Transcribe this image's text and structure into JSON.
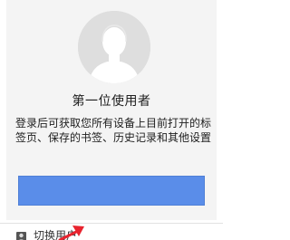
{
  "profile": {
    "name": "第一位使用者",
    "description": "登录后可获取您所有设备上目前打开的标签页、保存的书签、历史记录和其他设置",
    "signin_button_label": "",
    "avatar_icon": "person-silhouette-icon"
  },
  "menu": {
    "switch_user_label": "切换用户",
    "switch_user_icon": "person-icon"
  },
  "colors": {
    "card_background": "#f4f4f4",
    "avatar_background": "#dedede",
    "signin_button": "#5a8de9",
    "arrow_annotation": "#e8232e"
  }
}
